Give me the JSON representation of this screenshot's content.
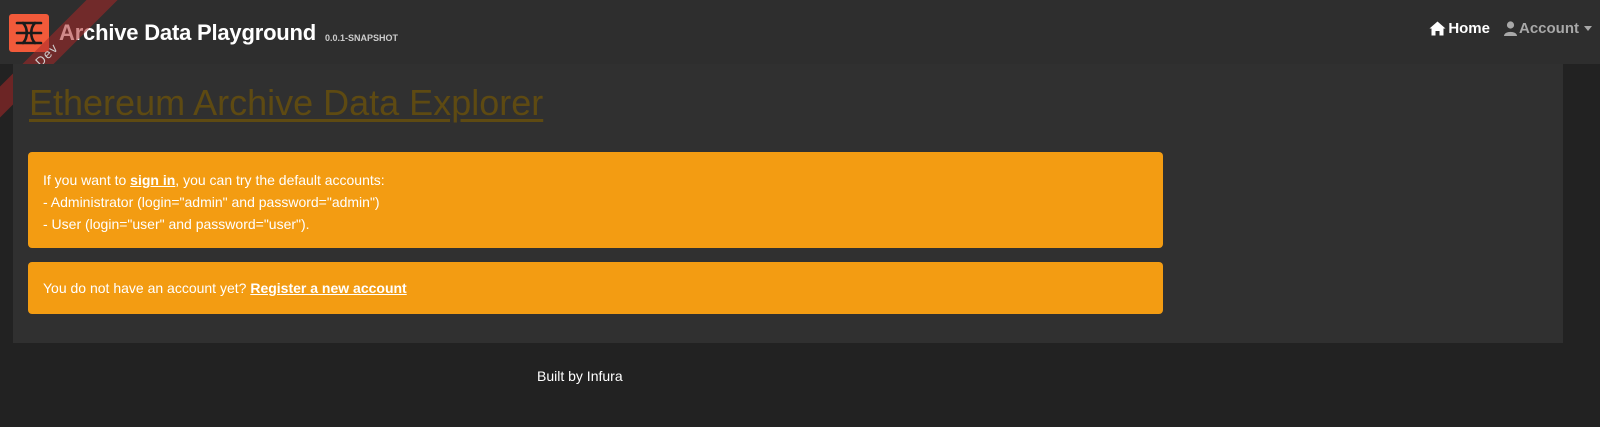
{
  "navbar": {
    "ribbon_text": "Dev",
    "brand_title": "Archive Data Playground",
    "version": "0.0.1-SNAPSHOT",
    "home_label": "Home",
    "account_label": "Account"
  },
  "main": {
    "title": "Ethereum Archive Data Explorer",
    "signin_alert": {
      "prefix": "If you want to ",
      "link": " sign in",
      "suffix": ", you can try the default accounts:",
      "line_admin": "- Administrator (login=\"admin\" and password=\"admin\")",
      "line_user": "- User (login=\"user\" and password=\"user\")."
    },
    "register_alert": {
      "text": "You do not have an account yet? ",
      "link": "Register a new account"
    }
  },
  "footer": {
    "text": "Built by Infura"
  },
  "colors": {
    "background": "#222222",
    "navbar": "#2e2e2e",
    "card": "#303030",
    "alert_warning": "#f39c12",
    "title_link": "#5e4a12",
    "logo": "#f15a3a",
    "ribbon": "#aa2828"
  },
  "icons": {
    "logo": "archive-logo-icon",
    "home": "home-icon",
    "account": "user-icon",
    "dropdown": "caret-down-icon"
  }
}
